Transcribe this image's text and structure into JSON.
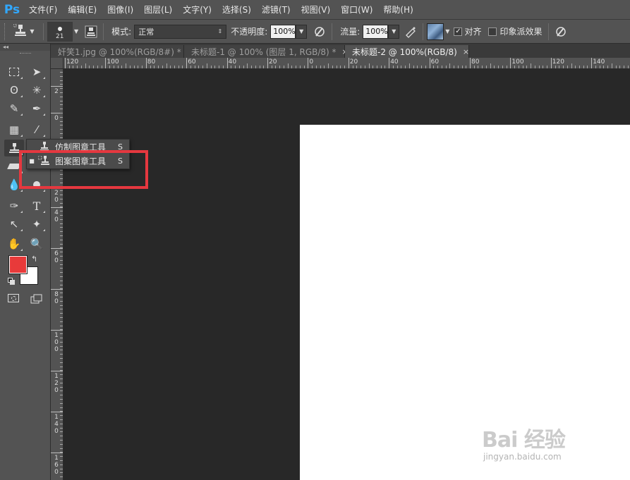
{
  "app": {
    "logo": "Ps",
    "menu": [
      "文件(F)",
      "编辑(E)",
      "图像(I)",
      "图层(L)",
      "文字(Y)",
      "选择(S)",
      "滤镜(T)",
      "视图(V)",
      "窗口(W)",
      "帮助(H)"
    ]
  },
  "options": {
    "brush_size": "21",
    "mode_label": "模式:",
    "mode_value": "正常",
    "opacity_label": "不透明度:",
    "opacity_value": "100%",
    "flow_label": "流量:",
    "flow_value": "100%",
    "aligned_label": "对齐",
    "aligned_checked": true,
    "impressionist_label": "印象派效果",
    "impressionist_checked": false
  },
  "toolbox": {
    "collapse": "◂◂",
    "foreground_color": "#e83a3a",
    "background_color": "#ffffff"
  },
  "tabs": [
    {
      "label": "奸笑1.jpg @ 100%(RGB/8#) *",
      "close": "×",
      "active": false
    },
    {
      "label": "未标题-1 @ 100% (图层 1, RGB/8) *",
      "close": "×",
      "active": false
    },
    {
      "label": "未标题-2 @ 100%(RGB/8)",
      "close": "×",
      "active": true
    }
  ],
  "rulers": {
    "horizontal": [
      "120",
      "100",
      "80",
      "60",
      "40",
      "20",
      "0",
      "20",
      "40",
      "60",
      "80",
      "100",
      "120",
      "140"
    ],
    "vertical": [
      "2",
      "0",
      "0",
      "2 0",
      "4 0",
      "6 0",
      "8 0",
      "1 0 0",
      "1 2 0",
      "1 4 0",
      "1 6 0"
    ]
  },
  "flyout": {
    "items": [
      {
        "label": "仿制图章工具",
        "shortcut": "S",
        "selected": false
      },
      {
        "label": "图案图章工具",
        "shortcut": "S",
        "selected": true
      }
    ]
  },
  "watermark": {
    "text": "Bai 经验",
    "sub": "jingyan.baidu.com"
  }
}
